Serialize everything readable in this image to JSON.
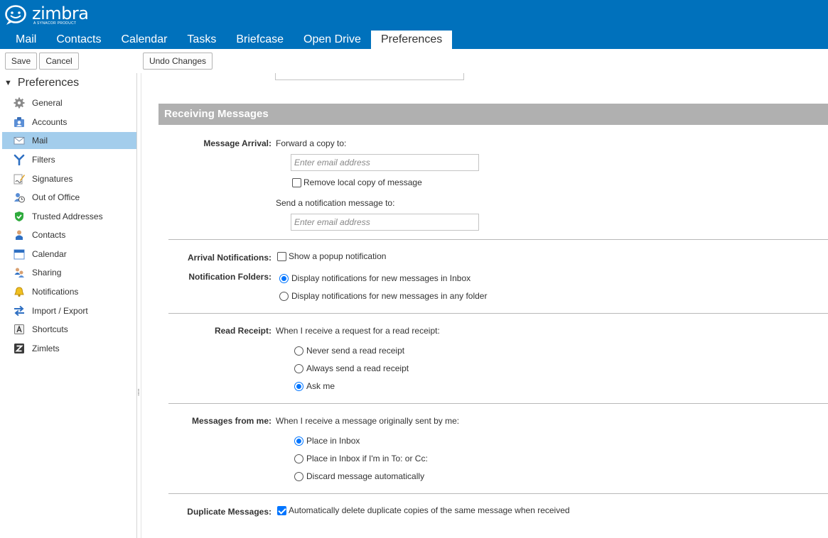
{
  "brand": {
    "name": "zimbra",
    "tagline": "A SYNACOR PRODUCT",
    "header_color": "#0071bc"
  },
  "tabs": [
    {
      "label": "Mail",
      "active": false
    },
    {
      "label": "Contacts",
      "active": false
    },
    {
      "label": "Calendar",
      "active": false
    },
    {
      "label": "Tasks",
      "active": false
    },
    {
      "label": "Briefcase",
      "active": false
    },
    {
      "label": "Open Drive",
      "active": false
    },
    {
      "label": "Preferences",
      "active": true
    }
  ],
  "toolbar": {
    "save_label": "Save",
    "cancel_label": "Cancel",
    "undo_label": "Undo Changes"
  },
  "sidebar": {
    "title": "Preferences",
    "items": [
      {
        "label": "General",
        "icon": "gear-icon"
      },
      {
        "label": "Accounts",
        "icon": "accounts-icon"
      },
      {
        "label": "Mail",
        "icon": "envelope-icon",
        "selected": true
      },
      {
        "label": "Filters",
        "icon": "filter-icon"
      },
      {
        "label": "Signatures",
        "icon": "signature-icon"
      },
      {
        "label": "Out of Office",
        "icon": "out-of-office-icon"
      },
      {
        "label": "Trusted Addresses",
        "icon": "shield-check-icon"
      },
      {
        "label": "Contacts",
        "icon": "person-icon"
      },
      {
        "label": "Calendar",
        "icon": "calendar-icon"
      },
      {
        "label": "Sharing",
        "icon": "sharing-icon"
      },
      {
        "label": "Notifications",
        "icon": "bell-icon"
      },
      {
        "label": "Import / Export",
        "icon": "import-export-icon"
      },
      {
        "label": "Shortcuts",
        "icon": "keyboard-icon"
      },
      {
        "label": "Zimlets",
        "icon": "zimlets-icon"
      }
    ]
  },
  "main": {
    "section_title": "Receiving Messages",
    "message_arrival": {
      "label": "Message Arrival:",
      "forward_text": "Forward a copy to:",
      "forward_placeholder": "Enter email address",
      "remove_local_label": "Remove local copy of message",
      "remove_local_checked": false,
      "notify_text": "Send a notification message to:",
      "notify_placeholder": "Enter email address"
    },
    "arrival_notifications": {
      "label": "Arrival Notifications:",
      "popup_label": "Show a popup notification",
      "popup_checked": false
    },
    "notification_folders": {
      "label": "Notification Folders:",
      "options": [
        {
          "label": "Display notifications for new messages in Inbox",
          "selected": true
        },
        {
          "label": "Display notifications for new messages in any folder",
          "selected": false
        }
      ]
    },
    "read_receipt": {
      "label": "Read Receipt:",
      "text": "When I receive a request for a read receipt:",
      "options": [
        {
          "label": "Never send a read receipt",
          "selected": false
        },
        {
          "label": "Always send a read receipt",
          "selected": false
        },
        {
          "label": "Ask me",
          "selected": true
        }
      ]
    },
    "messages_from_me": {
      "label": "Messages from me:",
      "text": "When I receive a message originally sent by me:",
      "options": [
        {
          "label": "Place in Inbox",
          "selected": true
        },
        {
          "label": "Place in Inbox if I'm in To: or Cc:",
          "selected": false
        },
        {
          "label": "Discard message automatically",
          "selected": false
        }
      ]
    },
    "duplicate_messages": {
      "label": "Duplicate Messages:",
      "option_label": "Automatically delete duplicate copies of the same message when received",
      "checked": true
    }
  }
}
